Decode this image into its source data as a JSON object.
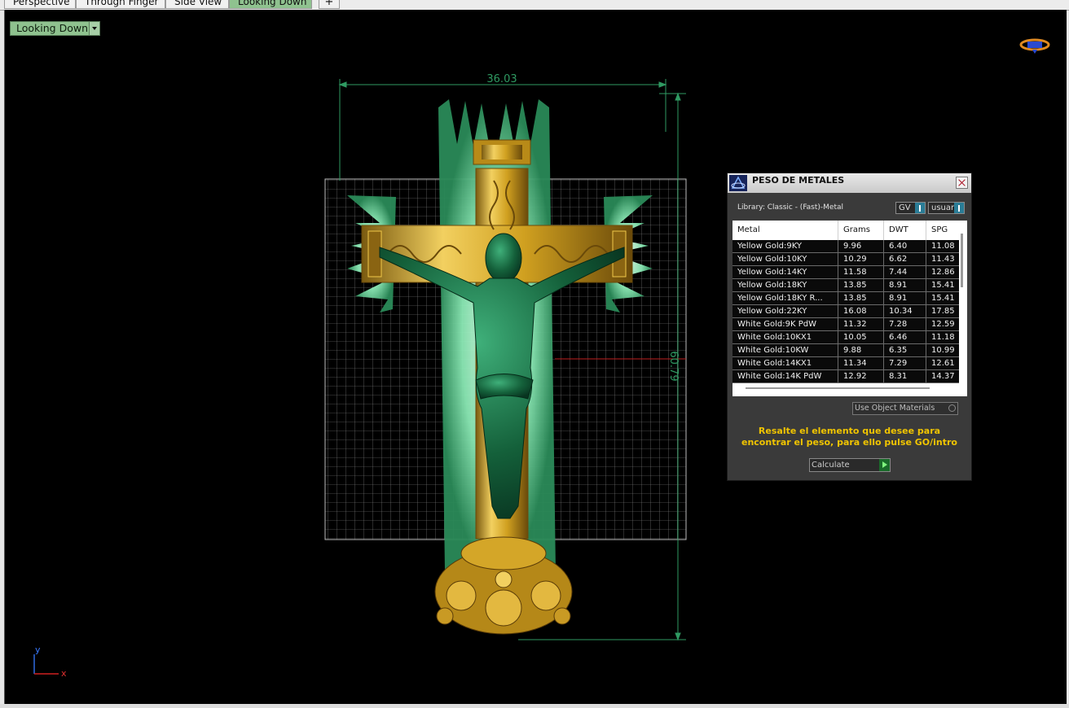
{
  "tabs": [
    {
      "label": "Perspective"
    },
    {
      "label": "Through Finger"
    },
    {
      "label": "Side View"
    },
    {
      "label": "Looking Down"
    },
    {
      "label": "+"
    }
  ],
  "viewport": {
    "view_label": "Looking Down",
    "dimension_width": "36.03",
    "dimension_height": "60.79",
    "axis_y": "y",
    "axis_x": "x"
  },
  "panel": {
    "title": "PESO DE METALES",
    "library": "Library: Classic - (Fast)-Metal",
    "unit_select": "GV",
    "user_select": "usuari",
    "columns": [
      "Metal",
      "Grams",
      "DWT",
      "SPG"
    ],
    "rows": [
      [
        "Yellow Gold:9KY",
        "9.96",
        "6.40",
        "11.08"
      ],
      [
        "Yellow Gold:10KY",
        "10.29",
        "6.62",
        "11.43"
      ],
      [
        "Yellow Gold:14KY",
        "11.58",
        "7.44",
        "12.86"
      ],
      [
        "Yellow Gold:18KY",
        "13.85",
        "8.91",
        "15.41"
      ],
      [
        "Yellow Gold:18KY R...",
        "13.85",
        "8.91",
        "15.41"
      ],
      [
        "Yellow Gold:22KY",
        "16.08",
        "10.34",
        "17.85"
      ],
      [
        "White Gold:9K PdW",
        "11.32",
        "7.28",
        "12.59"
      ],
      [
        "White Gold:10KX1",
        "10.05",
        "6.46",
        "11.18"
      ],
      [
        "White Gold:10KW",
        "9.88",
        "6.35",
        "10.99"
      ],
      [
        "White Gold:14KX1",
        "11.34",
        "7.29",
        "12.61"
      ],
      [
        "White Gold:14K PdW",
        "12.92",
        "8.31",
        "14.37"
      ]
    ],
    "use_object_materials": "Use Object Materials",
    "message_line1": "Resalte el elemento que desee para",
    "message_line2": "encontrar el peso, para ello pulse GO/intro",
    "calculate_label": "Calculate"
  },
  "colors": {
    "viewport_bg": "#000000",
    "tab_active": "#8fc28f",
    "dimension": "#2f9a62",
    "message": "#f0c400",
    "gold": "#d4a628",
    "jade": "#1f7a4a",
    "glow": "#a8f0c8"
  }
}
